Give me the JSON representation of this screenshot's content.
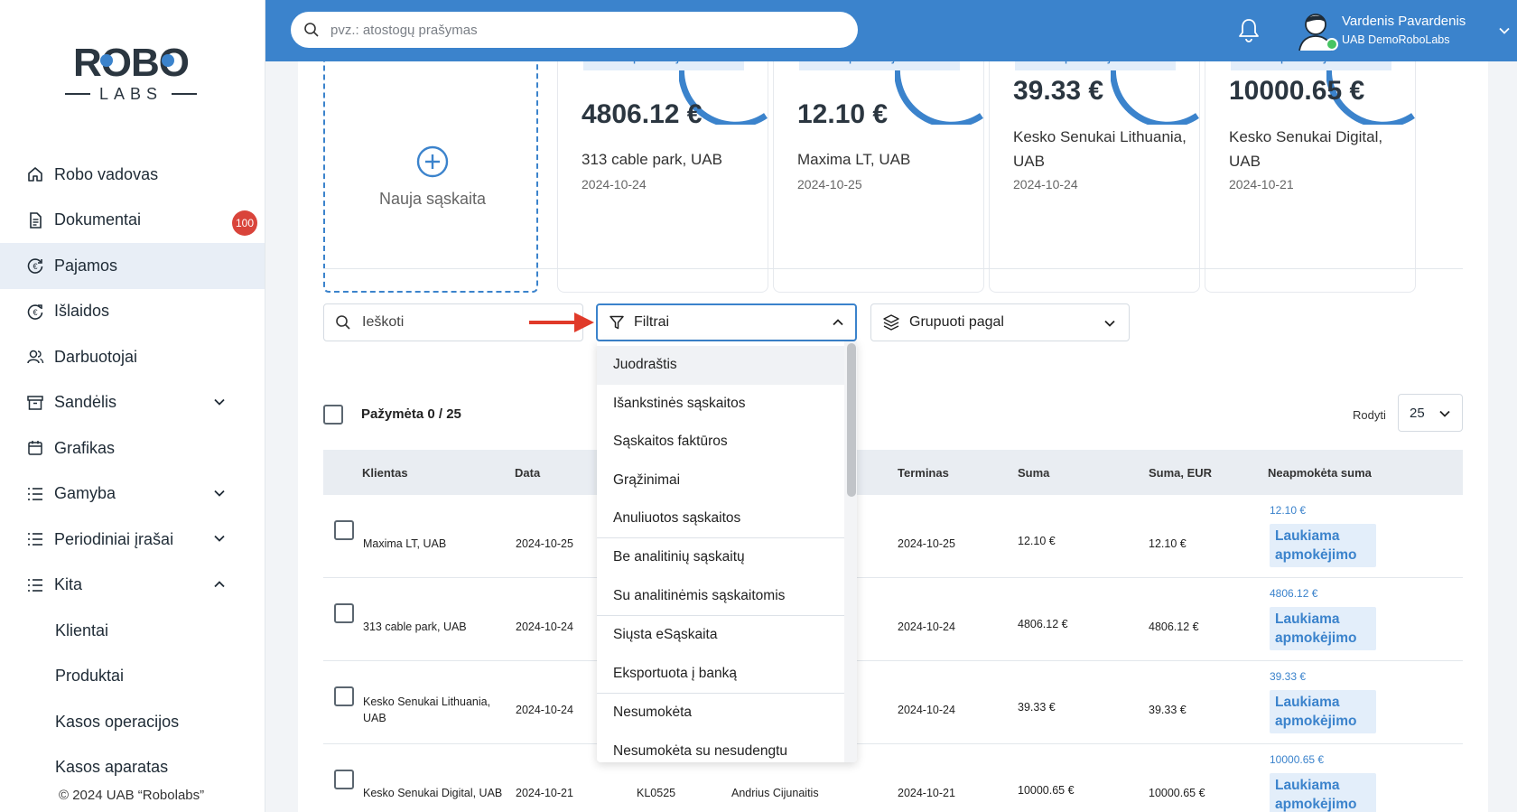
{
  "sidebar": {
    "logo": {
      "top": "ROBO",
      "bottom": "LABS"
    },
    "items": [
      {
        "label": "Robo vadovas",
        "icon": "home-icon"
      },
      {
        "label": "Dokumentai",
        "icon": "document-icon",
        "badge": "100"
      },
      {
        "label": "Pajamos",
        "icon": "income-icon",
        "active": true
      },
      {
        "label": "Išlaidos",
        "icon": "expense-icon"
      },
      {
        "label": "Darbuotojai",
        "icon": "users-icon"
      },
      {
        "label": "Sandėlis",
        "icon": "archive-icon",
        "expand": "down"
      },
      {
        "label": "Grafikas",
        "icon": "calendar-icon"
      },
      {
        "label": "Gamyba",
        "icon": "list-icon",
        "expand": "down"
      },
      {
        "label": "Periodiniai įrašai",
        "icon": "list-icon",
        "expand": "down"
      },
      {
        "label": "Kita",
        "icon": "list-icon",
        "expand": "up"
      }
    ],
    "sub_items": [
      "Klientai",
      "Produktai",
      "Kasos operacijos",
      "Kasos aparatas"
    ],
    "copyright": "© 2024 UAB “Robolabs”"
  },
  "header": {
    "search_placeholder": "pvz.: atostogų prašymas",
    "user_name": "Vardenis Pavardenis",
    "user_company": "UAB DemoRoboLabs"
  },
  "cards": {
    "new_label": "Nauja sąskaita",
    "tag_text": "apmokėjimo",
    "items": [
      {
        "amount": "4806.12 €",
        "client": "313 cable park, UAB",
        "date": "2024-10-24"
      },
      {
        "amount": "12.10 €",
        "client": "Maxima LT, UAB",
        "date": "2024-10-25"
      },
      {
        "amount": "39.33 €",
        "client": "Kesko Senukai Lithuania, UAB",
        "date": "2024-10-24"
      },
      {
        "amount": "10000.65 €",
        "client": "Kesko Senukai Digital, UAB",
        "date": "2024-10-21"
      }
    ]
  },
  "toolbar": {
    "search_label": "Ieškoti",
    "filters_label": "Filtrai",
    "group_label": "Grupuoti pagal",
    "selected_label": "Pažymėta 0 / 25",
    "show_label": "Rodyti",
    "per_page": "25"
  },
  "filters_dropdown": [
    "Juodraštis",
    "Išankstinės sąskaitos",
    "Sąskaitos faktūros",
    "Grąžinimai",
    "Anuliuotos sąskaitos",
    "Be analitinių sąskaitų",
    "Su analitinėmis sąskaitomis",
    "Siųsta eSąskaita",
    "Eksportuota į banką",
    "Nesumokėta",
    "Nesumokėta su nesudengtu"
  ],
  "table": {
    "headers": {
      "client": "Klientas",
      "date": "Data",
      "term": "Terminas",
      "sum": "Suma",
      "sum_eur": "Suma, EUR",
      "unpaid": "Neapmokėta suma"
    },
    "rows": [
      {
        "client": "Maxima LT, UAB",
        "date": "2024-10-25",
        "number": "",
        "person": "",
        "term": "2024-10-25",
        "sum": "12.10 €",
        "sum_eur": "12.10 €",
        "unpaid": "12.10 €",
        "status": "Laukiama apmokėjimo"
      },
      {
        "client": "313 cable park, UAB",
        "date": "2024-10-24",
        "number": "",
        "person": "",
        "term": "2024-10-24",
        "sum": "4806.12 €",
        "sum_eur": "4806.12 €",
        "unpaid": "4806.12 €",
        "status": "Laukiama apmokėjimo"
      },
      {
        "client": "Kesko Senukai Lithuania, UAB",
        "date": "2024-10-24",
        "number": "",
        "person": "",
        "term": "2024-10-24",
        "sum": "39.33 €",
        "sum_eur": "39.33 €",
        "unpaid": "39.33 €",
        "status": "Laukiama apmokėjimo"
      },
      {
        "client": "Kesko Senukai Digital, UAB",
        "date": "2024-10-21",
        "number": "KL0525",
        "person": "Andrius Cijunaitis",
        "term": "2024-10-21",
        "sum": "10000.65 €",
        "sum_eur": "10000.65 €",
        "unpaid": "10000.65 €",
        "status": "Laukiama apmokėjimo"
      }
    ]
  },
  "colors": {
    "brand": "#3b83cc",
    "badge": "#d9443b",
    "online": "#46c463",
    "arrow": "#e03a2a"
  }
}
